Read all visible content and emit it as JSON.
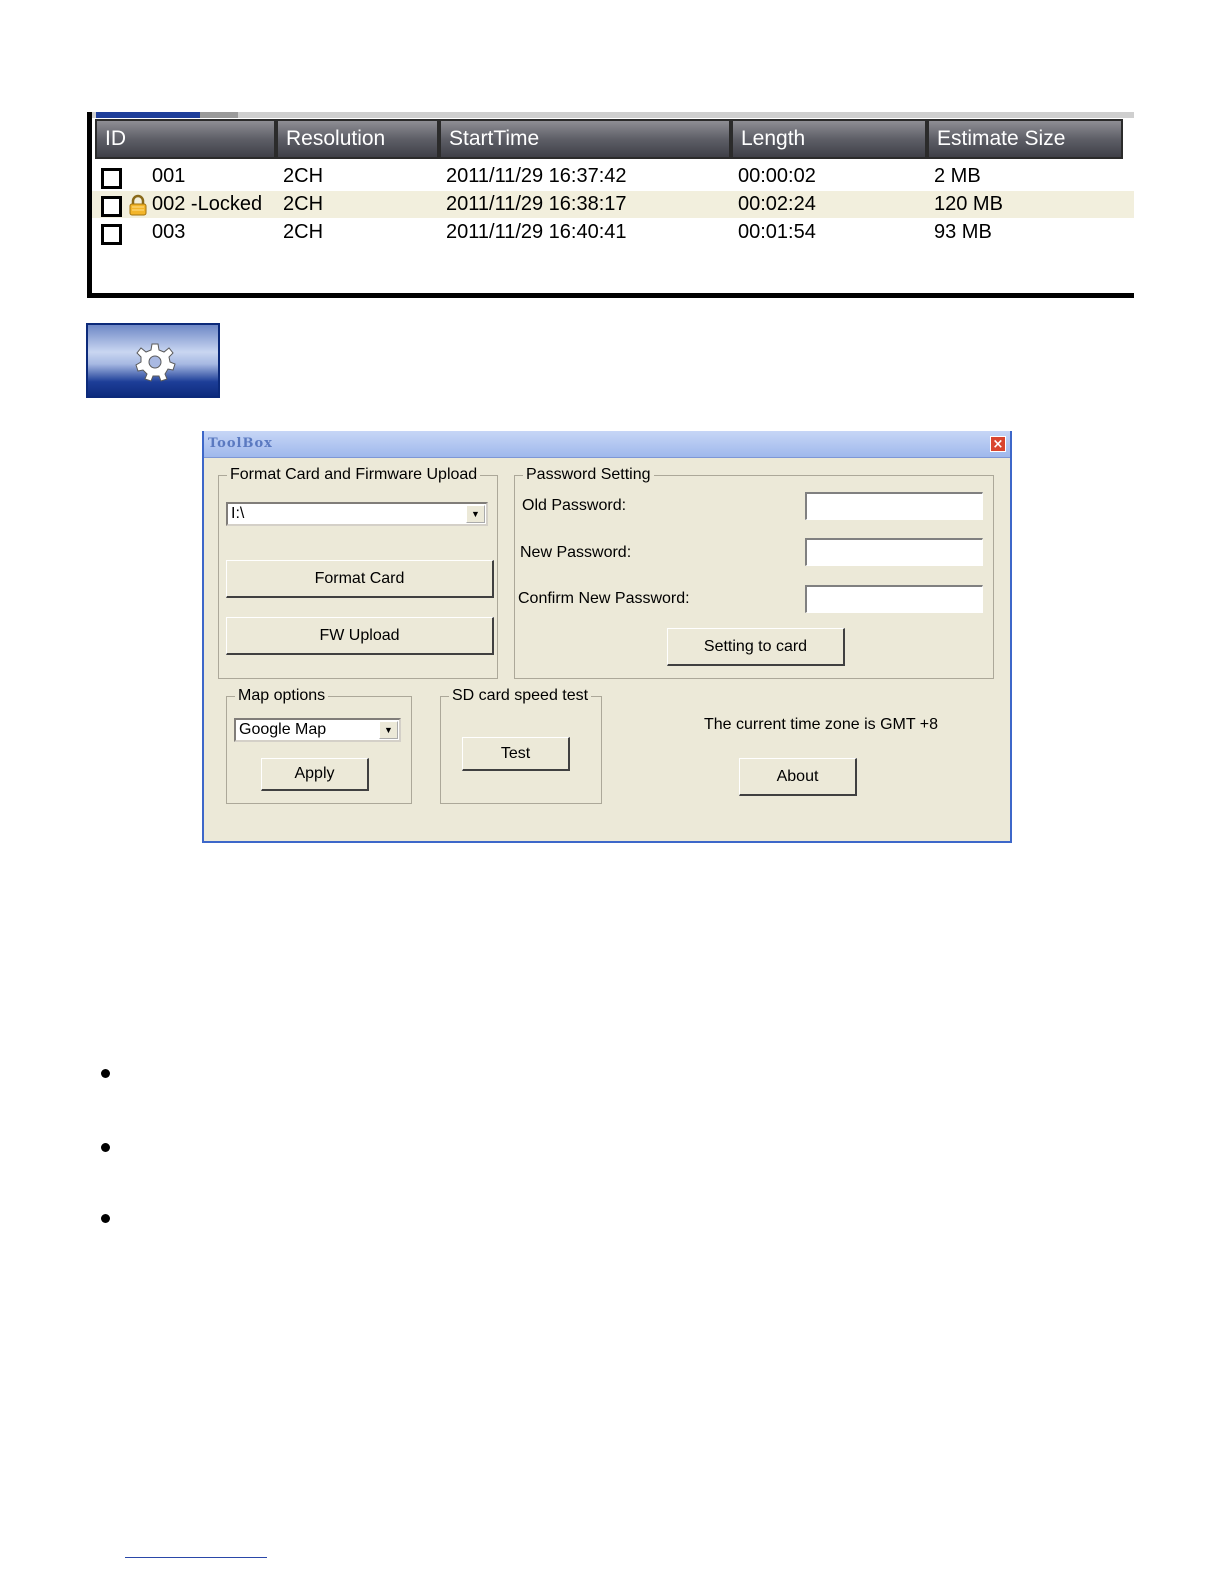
{
  "file_list": {
    "columns": [
      "ID",
      "Resolution",
      "StartTime",
      "Length",
      "Estimate Size"
    ],
    "rows": [
      {
        "id": "001",
        "resolution": "2CH",
        "start_time": "2011/11/29 16:37:42",
        "length": "00:00:02",
        "size": "2 MB",
        "locked": false
      },
      {
        "id": "002 -Locked",
        "resolution": "2CH",
        "start_time": "2011/11/29 16:38:17",
        "length": "00:02:24",
        "size": "120 MB",
        "locked": true
      },
      {
        "id": "003",
        "resolution": "2CH",
        "start_time": "2011/11/29 16:40:41",
        "length": "00:01:54",
        "size": "93 MB",
        "locked": false
      }
    ]
  },
  "settings_button": {
    "icon": "gear-icon"
  },
  "toolbox": {
    "title": "ToolBox",
    "close_label": "×",
    "format_group": {
      "title": "Format Card and Firmware Upload",
      "drive_value": "I:\\",
      "format_button": "Format Card",
      "fw_button": "FW Upload"
    },
    "password_group": {
      "title": "Password Setting",
      "old_label": "Old Password:",
      "new_label": "New Password:",
      "confirm_label": "Confirm New Password:",
      "old_value": "",
      "new_value": "",
      "confirm_value": "",
      "submit_button": "Setting to card"
    },
    "map_group": {
      "title": "Map options",
      "selected": "Google Map",
      "apply_button": "Apply"
    },
    "speed_group": {
      "title": "SD card speed test",
      "test_button": "Test"
    },
    "timezone_text": "The current time zone is GMT +8",
    "about_button": "About"
  },
  "colors": {
    "header_dark": "#3f4048",
    "dialog_bg": "#ece9d8",
    "dialog_border": "#3d67c9",
    "alt_row": "#f2efdd"
  }
}
